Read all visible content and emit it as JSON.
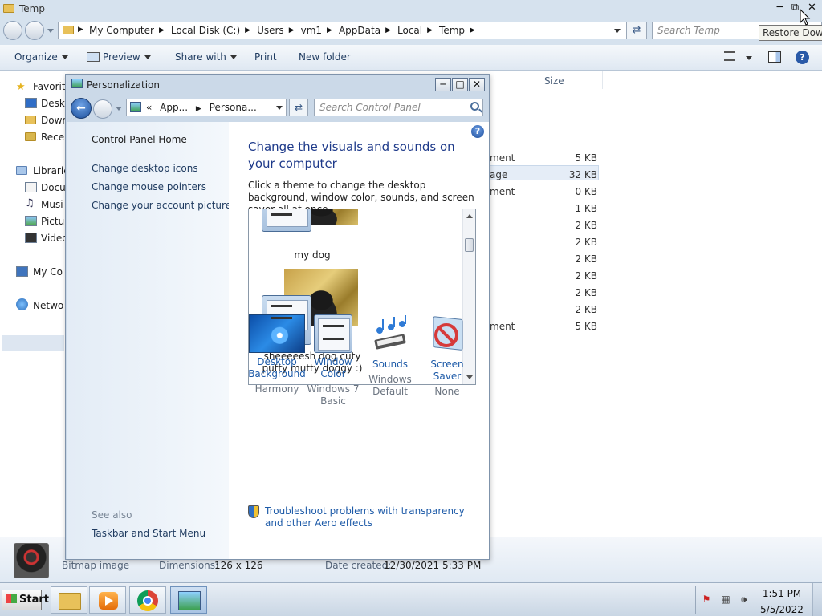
{
  "explorer": {
    "title": "Temp",
    "tooltip": "Restore Down",
    "breadcrumb": [
      "My Computer",
      "Local Disk (C:)",
      "Users",
      "vm1",
      "AppData",
      "Local",
      "Temp"
    ],
    "search_placeholder": "Search Temp",
    "toolbar": {
      "organize": "Organize",
      "preview": "Preview",
      "share_with": "Share with",
      "print": "Print",
      "new_folder": "New folder"
    },
    "nav": {
      "favorites": "Favorit",
      "desktop": "Deskt",
      "downloads": "Down",
      "recent": "Rece",
      "libraries": "Librarie",
      "documents": "Docu",
      "music": "Musi",
      "pictures": "Pictu",
      "videos": "Video",
      "computer": "My Co",
      "network": "Netwo"
    },
    "columns": {
      "size": "Size"
    },
    "rows": [
      {
        "type_fragment": "ment",
        "size": "5 KB"
      },
      {
        "type_fragment": "age",
        "size": "32 KB",
        "selected": true
      },
      {
        "type_fragment": "ment",
        "size": "0 KB"
      },
      {
        "type_fragment": "",
        "size": "1 KB"
      },
      {
        "type_fragment": "",
        "size": "2 KB"
      },
      {
        "type_fragment": "",
        "size": "2 KB"
      },
      {
        "type_fragment": "",
        "size": "2 KB"
      },
      {
        "type_fragment": "",
        "size": "2 KB"
      },
      {
        "type_fragment": "",
        "size": "2 KB"
      },
      {
        "type_fragment": "",
        "size": "2 KB"
      },
      {
        "type_fragment": "ment",
        "size": "5 KB"
      }
    ],
    "details": {
      "type": "Bitmap image",
      "dimensions_label": "Dimensions:",
      "dimensions_value": "126 x 126",
      "date_label": "Date created:",
      "date_value": "12/30/2021 5:33 PM"
    }
  },
  "dialog": {
    "title": "Personalization",
    "address": {
      "prefix": "«",
      "part1": "App...",
      "part2": "Persona..."
    },
    "search_placeholder": "Search Control Panel",
    "left": {
      "home": "Control Panel Home",
      "links": [
        "Change desktop icons",
        "Change mouse pointers",
        "Change your account picture"
      ],
      "see_also": "See also",
      "see_also_links": [
        "Taskbar and Start Menu"
      ]
    },
    "heading": "Change the visuals and sounds on your computer",
    "description": "Click a theme to change the desktop background, window color, sounds, and screen saver all at once.",
    "themes": [
      {
        "name": "my dog"
      },
      {
        "name": "sheeeeesh dog cuty putty mutty doggy :)"
      }
    ],
    "bottom": [
      {
        "label": "Desktop Background",
        "value": "Harmony",
        "icon": "desktop-background-icon"
      },
      {
        "label": "Window Color",
        "value": "Windows 7 Basic",
        "icon": "window-color-icon"
      },
      {
        "label": "Sounds",
        "value": "Windows Default",
        "icon": "sounds-icon"
      },
      {
        "label": "Screen Saver",
        "value": "None",
        "icon": "screen-saver-icon"
      }
    ],
    "troubleshoot": "Troubleshoot problems with transparency and other Aero effects"
  },
  "taskbar": {
    "start": "Start",
    "time": "1:51 PM",
    "date": "5/5/2022"
  }
}
